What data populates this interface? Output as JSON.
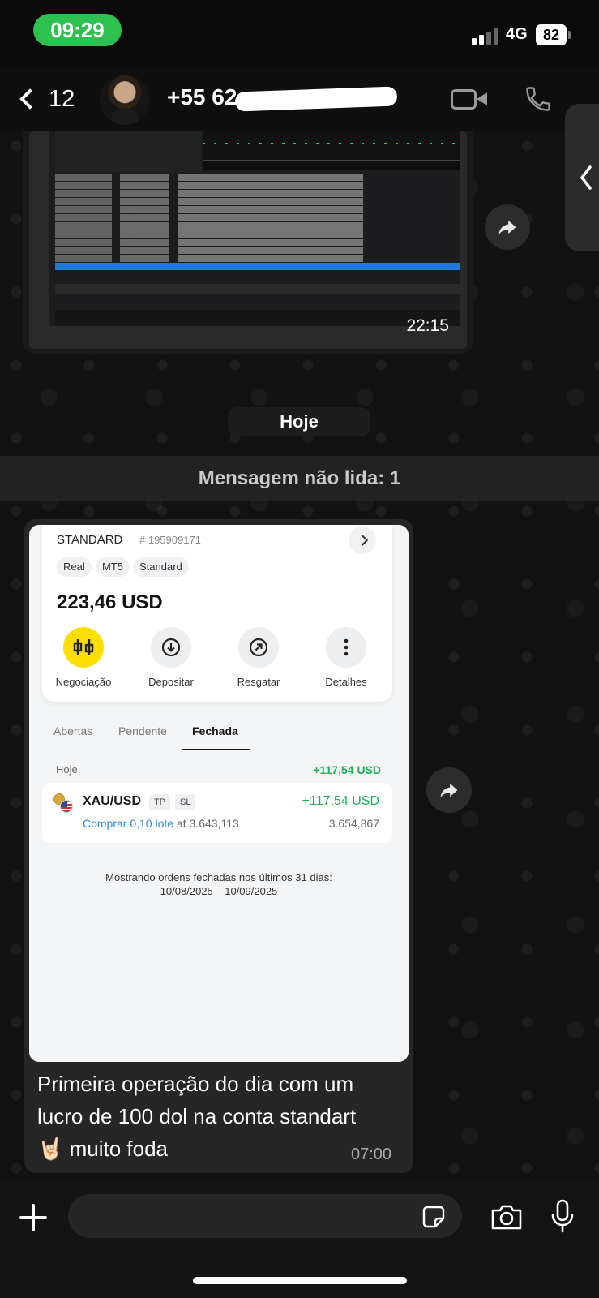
{
  "status_bar": {
    "time": "09:29",
    "network": "4G",
    "battery": "82",
    "accent_color": "#2fc14f"
  },
  "header": {
    "back_count": "12",
    "contact_name": "+55 62",
    "icons": [
      "back-chevron-icon",
      "avatar",
      "video-call-icon",
      "phone-icon"
    ]
  },
  "messages": {
    "photo_time": "22:15",
    "date_separator": "Hoje",
    "unread_banner": "Mensagem não lida: 1",
    "caption": "Primeira operação do dia com um lucro de 100 dol na conta standart 🤘🏻 muito foda",
    "caption_time": "07:00"
  },
  "trade_screenshot": {
    "account_type": "STANDARD",
    "account_number": "# 195909171",
    "tags": [
      "Real",
      "MT5",
      "Standard"
    ],
    "balance": "223,46 USD",
    "actions": [
      {
        "label": "Negociação",
        "icon": "candlestick-icon"
      },
      {
        "label": "Depositar",
        "icon": "download-circle-icon"
      },
      {
        "label": "Resgatar",
        "icon": "arrow-up-right-icon"
      },
      {
        "label": "Detalhes",
        "icon": "more-vertical-icon"
      }
    ],
    "tabs": [
      "Abertas",
      "Pendente",
      "Fechada"
    ],
    "active_tab": "Fechada",
    "group_date": "Hoje",
    "group_total": "+117,54 USD",
    "order": {
      "symbol": "XAU/USD",
      "chips": [
        "TP",
        "SL"
      ],
      "side": "Comprar 0,10 lote",
      "at_text": "at 3.643,113",
      "pnl": "+117,54 USD",
      "close_price": "3.654,867"
    },
    "footer_line1": "Mostrando ordens fechadas nos últimos 31 dias:",
    "footer_line2": "10/08/2025 – 10/09/2025",
    "profit_color": "#1fae52",
    "link_color": "#2c8be0",
    "brand_yellow": "#ffde02"
  },
  "input_bar": {
    "placeholder": ""
  }
}
